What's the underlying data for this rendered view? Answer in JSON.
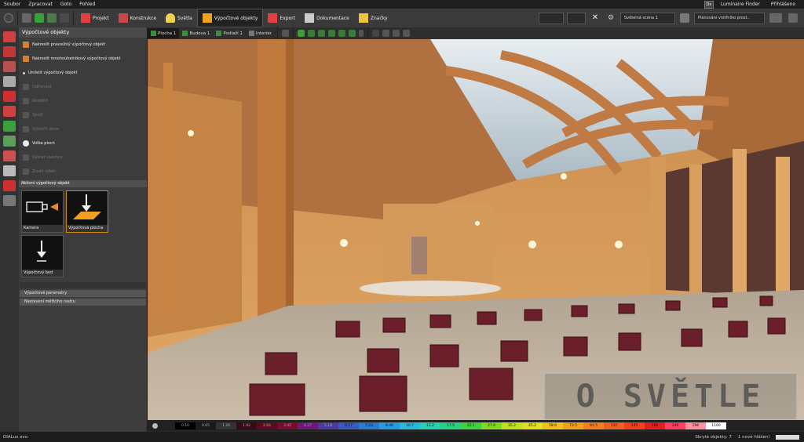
{
  "menu": {
    "items": [
      "Soubor",
      "Zpracovat",
      "Goto",
      "Pohled"
    ],
    "luminaire_finder": "Luminaire Finder",
    "account": "Přihlášeno"
  },
  "toolbar": {
    "tabs": [
      {
        "label": "Projekt",
        "icon": "project-icon",
        "color": "#e04040"
      },
      {
        "label": "Konstrukce",
        "icon": "construction-icon",
        "color": "#e04040"
      },
      {
        "label": "Světla",
        "icon": "lamp-icon",
        "color": "#f0d050"
      },
      {
        "label": "Výpočtové objekty",
        "icon": "calc-objects-icon",
        "color": "#f0a020"
      },
      {
        "label": "Export",
        "icon": "export-icon",
        "color": "#e04040"
      },
      {
        "label": "Dokumentace",
        "icon": "document-icon",
        "color": "#cccccc"
      },
      {
        "label": "Značky",
        "icon": "tags-icon",
        "color": "#f0c040"
      }
    ],
    "active_tab": "Výpočtové objekty",
    "scene_select": "Světelná scéna 1",
    "planning_select": "Plánování vnitřního prost.."
  },
  "sidebar_icons": [
    "plane-icon",
    "box-icon",
    "tile-icon",
    "cylinder-icon",
    "cube-icon",
    "l-shape-icon",
    "exit-icon",
    "eye-icon",
    "wave-icon",
    "doc-icon",
    "frame-icon",
    "grid-icon"
  ],
  "panel": {
    "title": "Výpočtové objekty",
    "items": [
      {
        "label": "Nakreslit pravoúhlý výpočtový objekt",
        "enabled": true
      },
      {
        "label": "Nakreslit mnohoúhelníkový výpočtový objekt",
        "enabled": true
      },
      {
        "label": "Umístit výpočtový objekt",
        "enabled": true
      },
      {
        "label": "Odříznout",
        "enabled": false
      },
      {
        "label": "Rozdělit",
        "enabled": false
      },
      {
        "label": "Spojit",
        "enabled": false
      },
      {
        "label": "Vytvořit otvor",
        "enabled": false
      },
      {
        "label": "Volba ploch",
        "enabled": true
      },
      {
        "label": "Vybrat všechny",
        "enabled": false
      },
      {
        "label": "Zrušit výběr",
        "enabled": false
      }
    ],
    "active_section": "Aktivní výpočtový objekt",
    "tiles": [
      {
        "label": "Kamera",
        "selected": false
      },
      {
        "label": "Výpočtová plocha",
        "selected": true
      },
      {
        "label": "Výpočtový bod",
        "selected": false
      }
    ],
    "collapsed": [
      "Výpočtové parametry",
      "Nastavení měřicího rastru"
    ]
  },
  "view": {
    "tabs": [
      "Plocha 1",
      "Budova 1",
      "Podlaží 1",
      "Interiér"
    ]
  },
  "legend": {
    "values": [
      "0.10",
      "0.65",
      "1.26",
      "1.92",
      "2.64",
      "3.42",
      "4.27",
      "5.18",
      "6.17",
      "7.23",
      "8.46",
      "10.7",
      "13.2",
      "17.5",
      "22.1",
      "27.4",
      "35.2",
      "45.2",
      "58.6",
      "72.5",
      "91.5",
      "115",
      "145",
      "186",
      "240",
      "296",
      "1100"
    ],
    "colors": [
      "#000000",
      "#1a1a1a",
      "#333333",
      "#3a0a14",
      "#5a0a1e",
      "#7a0a2e",
      "#6a1a7a",
      "#4a3aa0",
      "#3a5ac0",
      "#2a7ad0",
      "#2a9ae0",
      "#2ab8d8",
      "#2ad0b0",
      "#2ad080",
      "#40d040",
      "#80d820",
      "#c0e020",
      "#e0e020",
      "#f0c020",
      "#f0a020",
      "#f08020",
      "#f06020",
      "#f04020",
      "#e02020",
      "#ff4060",
      "#ff90a0",
      "#ffffff"
    ]
  },
  "status": {
    "app": "DIALux evo",
    "hidden": "Skryté objekty: 7",
    "selection": "1 nové hlášení"
  },
  "watermark": "O SVĚTLE"
}
